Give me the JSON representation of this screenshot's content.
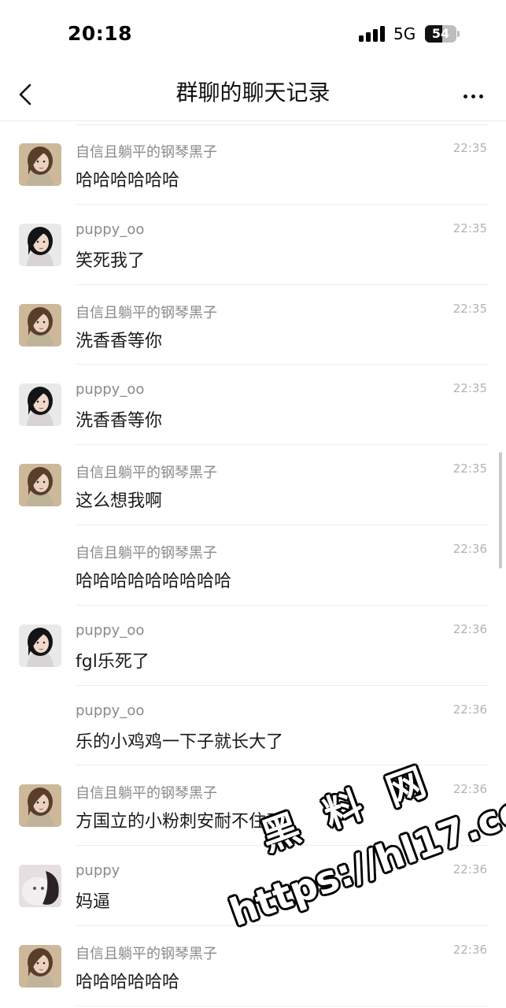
{
  "status_bar": {
    "time": "20:18",
    "network": "5G",
    "battery_level": "54",
    "signal_bars_filled": 4
  },
  "nav": {
    "title": "群聊的聊天记录",
    "back_icon": "chevron-left-icon",
    "more_icon": "ellipsis-icon"
  },
  "avatars": {
    "a": {
      "desc": "girl-avatar-brown-hair",
      "bg": "#cdb89a",
      "hair": "#5a3d2b",
      "skin": "#ead2bf",
      "cloth": "#bfb49a"
    },
    "b": {
      "desc": "girl-avatar-black-hair",
      "bg": "#e9e9e9",
      "hair": "#141414",
      "skin": "#eed9cc",
      "cloth": "#d8d4d4"
    },
    "c": {
      "desc": "cat-avatar",
      "bg": "#e6dfe1",
      "hair": "#2a2223",
      "skin": "#f3eef0",
      "cloth": "#cfc4c6"
    }
  },
  "messages": [
    {
      "sender": "自信且躺平的钢琴黑子",
      "time": "22:35",
      "text": "哈哈哈哈哈哈",
      "avatar": "a"
    },
    {
      "sender": "puppy_oo",
      "time": "22:35",
      "text": "笑死我了",
      "avatar": "b"
    },
    {
      "sender": "自信且躺平的钢琴黑子",
      "time": "22:35",
      "text": "洗香香等你",
      "avatar": "a"
    },
    {
      "sender": "puppy_oo",
      "time": "22:35",
      "text": "洗香香等你",
      "avatar": "b"
    },
    {
      "sender": "自信且躺平的钢琴黑子",
      "time": "22:35",
      "text": "这么想我啊",
      "avatar": "a"
    },
    {
      "sender": "自信且躺平的钢琴黑子",
      "time": "22:36",
      "text": "哈哈哈哈哈哈哈哈哈",
      "avatar": null
    },
    {
      "sender": "puppy_oo",
      "time": "22:36",
      "text": "fgl乐死了",
      "avatar": "b"
    },
    {
      "sender": "puppy_oo",
      "time": "22:36",
      "text": "乐的小鸡鸡一下子就长大了",
      "avatar": null
    },
    {
      "sender": "自信且躺平的钢琴黑子",
      "time": "22:36",
      "text": "方国立的小粉刺安耐不住了",
      "avatar": "a"
    },
    {
      "sender": "puppy",
      "time": "22:36",
      "text": "妈逼",
      "avatar": "c"
    },
    {
      "sender": "自信且躺平的钢琴黑子",
      "time": "22:36",
      "text": "哈哈哈哈哈哈",
      "avatar": "a"
    }
  ],
  "watermark": {
    "line1": "黑 料 网",
    "line2": "https://hl17.co"
  },
  "colors": {
    "sender_gray": "#8a8a8a",
    "time_gray": "#b3b3b3",
    "divider": "#ededed"
  }
}
